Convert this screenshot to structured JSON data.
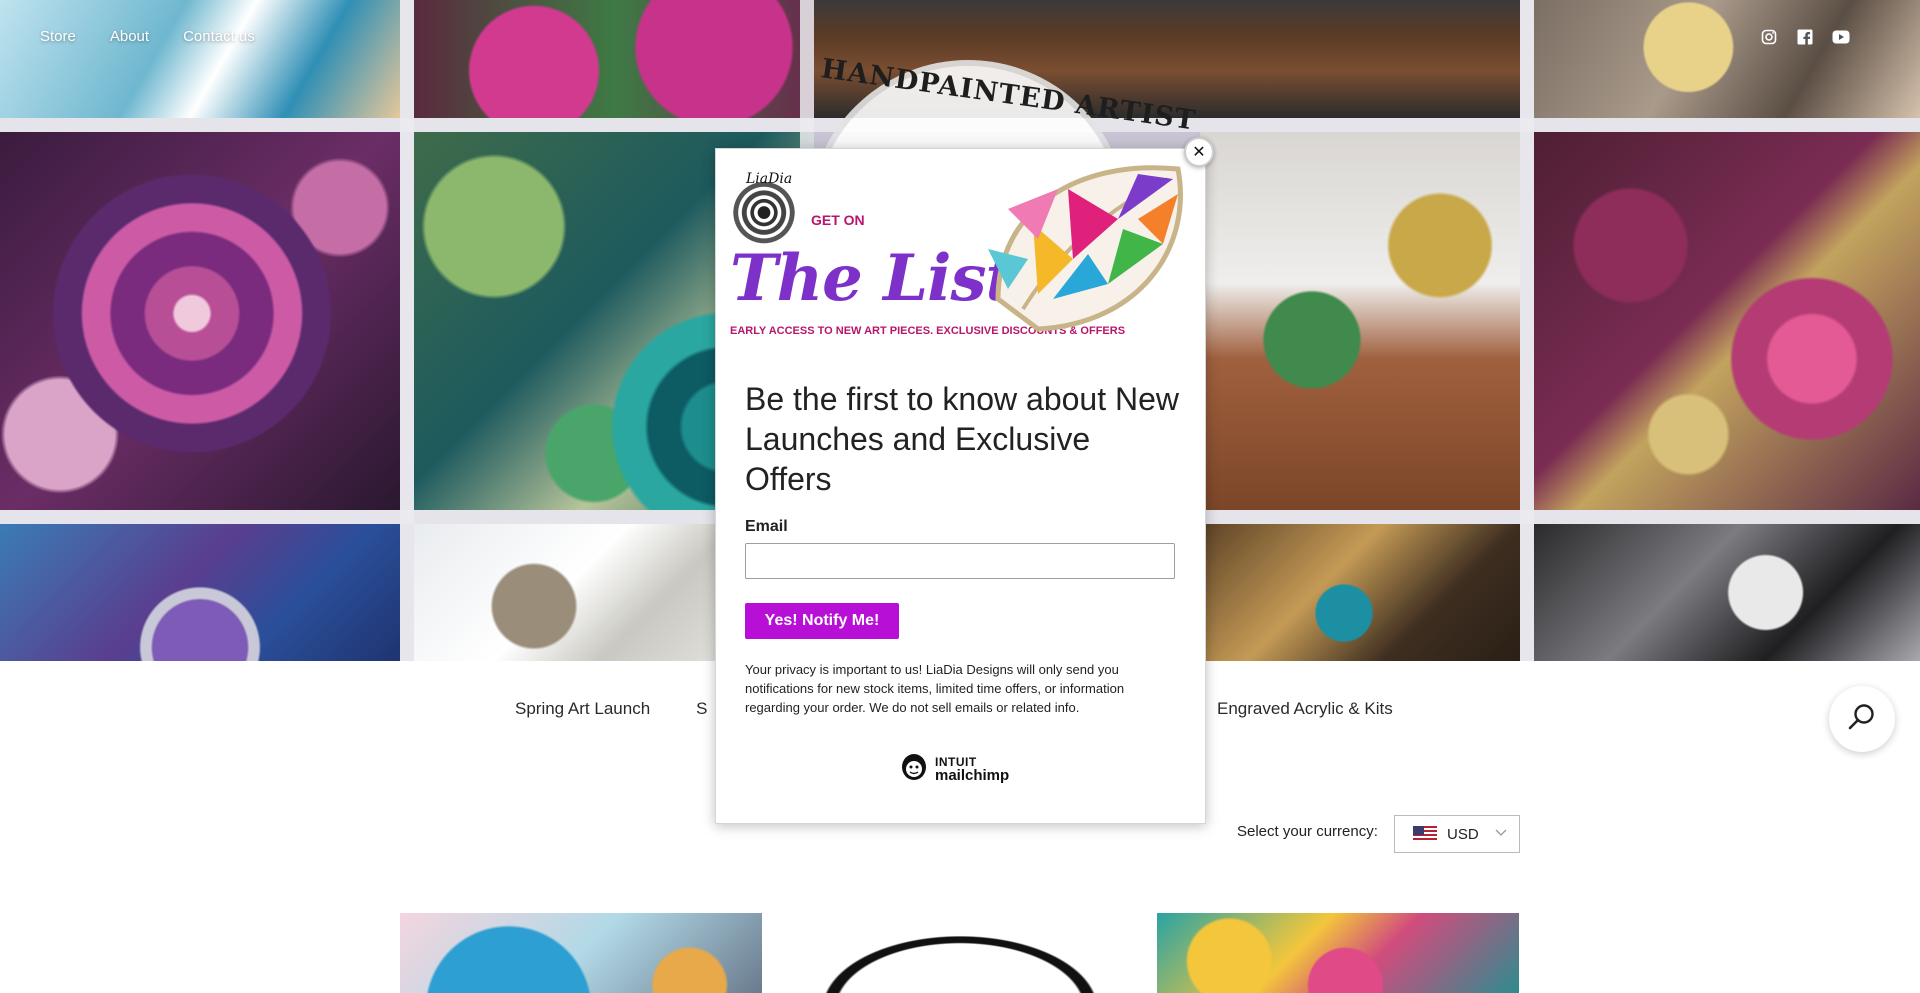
{
  "nav": {
    "items": [
      "Store",
      "About",
      "Contact us"
    ]
  },
  "social": {
    "icons": [
      "instagram-icon",
      "facebook-icon",
      "youtube-icon"
    ]
  },
  "hero": {
    "logo_text": "HANDPAINTED ARTIST"
  },
  "categories": {
    "left": [
      "Spring Art Launch",
      "S"
    ],
    "right": "Engraved Acrylic & Kits"
  },
  "currency": {
    "label": "Select your currency:",
    "selected": "USD"
  },
  "popup": {
    "banner": {
      "brand": "LiaDia",
      "get_on": "GET ON",
      "the_list": "The List",
      "tagline": "EARLY ACCESS TO NEW ART PIECES. EXCLUSIVE DISCOUNTS & OFFERS"
    },
    "headline": "Be the first to know about New Launches and Exclusive Offers",
    "email_label": "Email",
    "email_value": "",
    "submit_label": "Yes! Notify Me!",
    "privacy": "Your privacy is important to us! LiaDia Designs will only send you notifications for new stock items, limited time offers, or information regarding your order. We do not sell emails or related info.",
    "badge_top": "INTUIT",
    "badge_bottom": "mailchimp",
    "close_label": "✕"
  },
  "colors": {
    "submit": "#b70fd6",
    "the_list": "#7d31c9",
    "accent_magenta": "#b7156b"
  }
}
